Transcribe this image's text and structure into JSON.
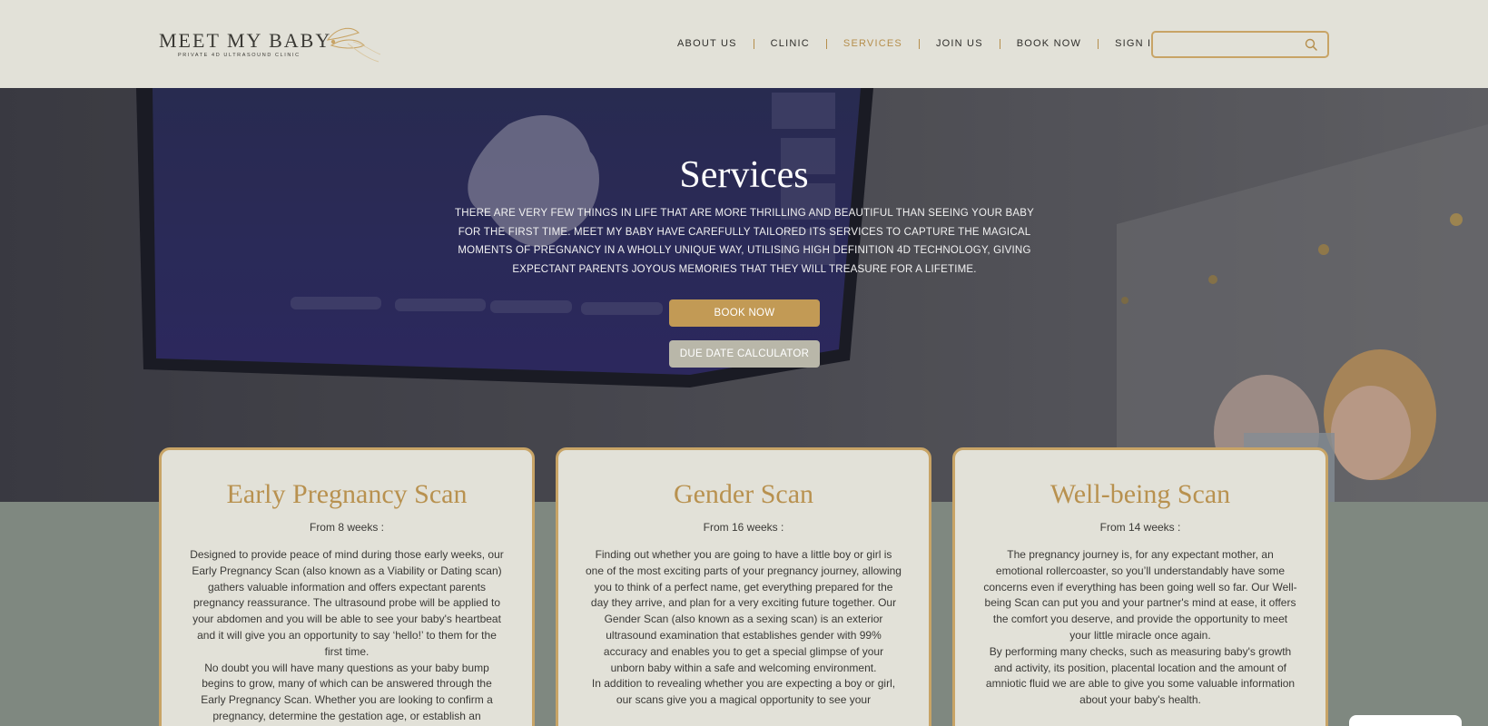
{
  "logo": {
    "title": "MEET MY BABY",
    "subtitle": "PRIVATE 4D ULTRASOUND CLINIC"
  },
  "nav": {
    "items": [
      {
        "label": "ABOUT US"
      },
      {
        "label": "CLINIC"
      },
      {
        "label": "SERVICES",
        "active": true
      },
      {
        "label": "JOIN US"
      },
      {
        "label": "BOOK NOW"
      },
      {
        "label": "SIGN IN"
      }
    ]
  },
  "search": {
    "placeholder": "",
    "value": ""
  },
  "hero": {
    "title": "Services",
    "text": "There are very few things in life that are more thrilling and beautiful than seeing your baby for the first time. Meet My Baby have carefully tailored its services to capture the magical moments of pregnancy in a wholly unique way, utilising high definition 4D technology, giving expectant parents joyous memories that they will treasure for a lifetime.",
    "book_button": "BOOK NOW",
    "due_date_button": "DUE DATE CALCULATOR"
  },
  "cards": [
    {
      "title": "Early Pregnancy Scan",
      "from": "From 8 weeks :",
      "body_1": "Designed to provide peace of mind during those early weeks, our Early Pregnancy Scan (also known as a Viability or Dating scan) gathers valuable information and offers expectant parents pregnancy reassurance. The ultrasound probe will be applied to your abdomen and you will be able to see your baby's heartbeat and it will give you an opportunity to say ‘hello!’ to them for the first time.",
      "body_2": "No doubt you will have many questions as your baby bump begins to grow, many of which can be answered through the Early Pregnancy Scan. Whether you are looking to confirm a pregnancy, determine the gestation age, or establish an"
    },
    {
      "title": "Gender Scan",
      "from": "From 16 weeks :",
      "body_1": "Finding out whether you are going to have a little boy or girl is one of the most exciting parts of your pregnancy journey, allowing you to think of a perfect name, get everything prepared for the day they arrive, and plan for a very exciting future together. Our Gender Scan (also known as a sexing scan) is an exterior ultrasound examination that establishes gender with 99% accuracy and enables you to get a special glimpse of your unborn baby within a safe and welcoming environment.",
      "body_2": "In addition to revealing whether you are expecting a boy or girl, our scans give you a magical opportunity to see your"
    },
    {
      "title": "Well-being Scan",
      "from": "From 14 weeks :",
      "body_1": "The pregnancy journey is, for any expectant mother, an emotional rollercoaster, so you’ll understandably have some concerns even if everything has been going well so far. Our Well-being Scan can put you and your partner's mind at ease, it offers the comfort you deserve, and provide the opportunity to meet your little miracle once again.",
      "body_2": "By performing many checks, such as measuring baby's growth and activity, its position, placental location and the amount of amniotic fluid we are able to give you some valuable information about your baby's health."
    }
  ],
  "colors": {
    "header_bg": "#e2e1d8",
    "accent_gold": "#c29a55",
    "page_bg": "#7f8880",
    "card_bg": "#e2e1d8"
  }
}
